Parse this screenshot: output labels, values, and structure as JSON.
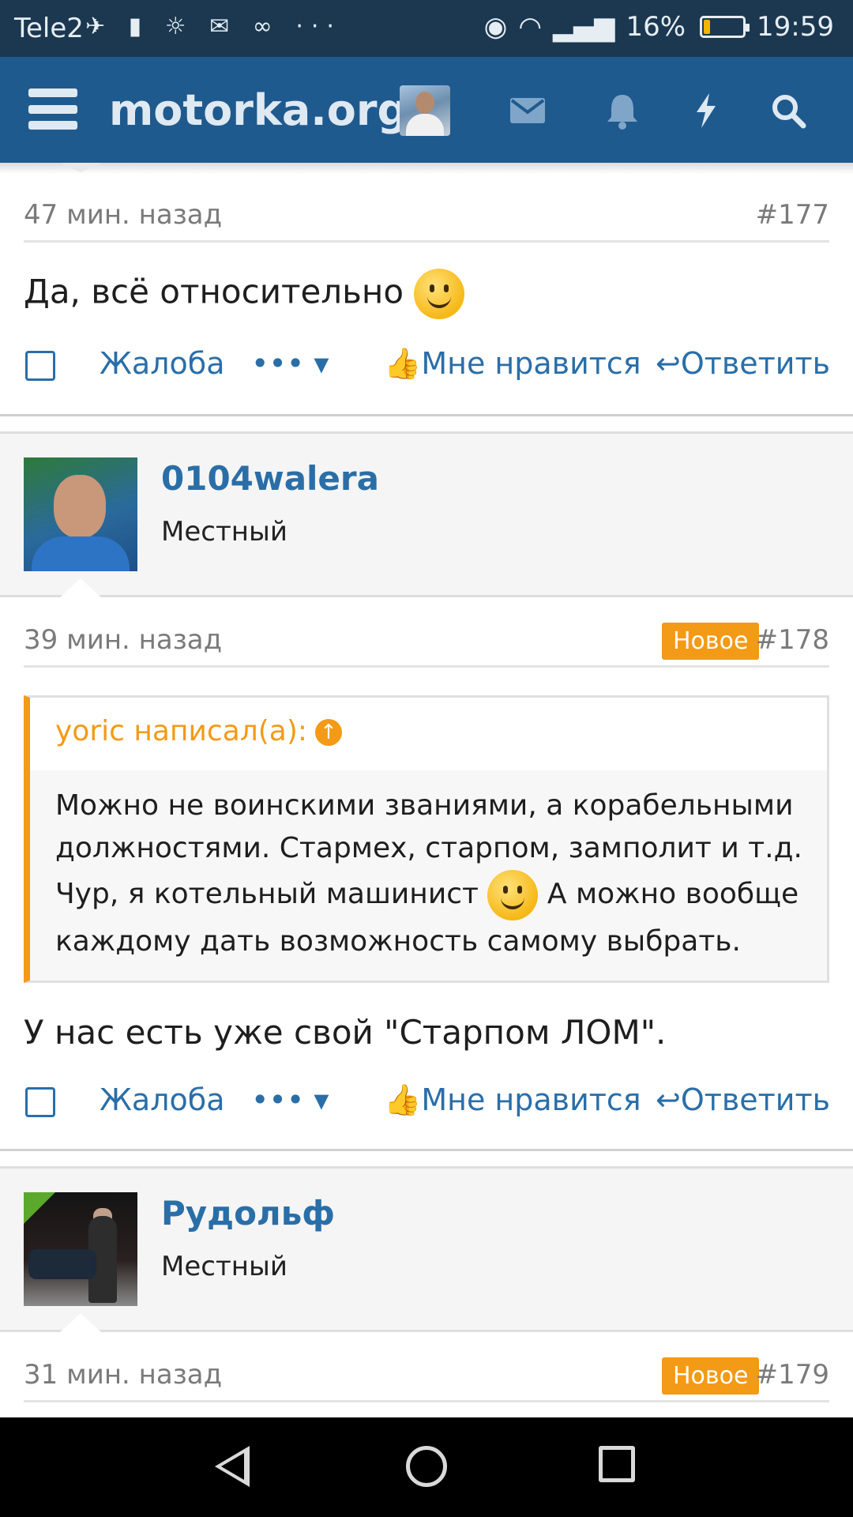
{
  "status_bar": {
    "carrier": "Tele2",
    "notification_icons": "✈ ▮ ☼ ✉ ∞ ···",
    "battery_percent": "16%",
    "time": "19:59",
    "battery_level": 0.16
  },
  "header": {
    "site_name": "motorka.org",
    "icons": [
      "menu-icon",
      "avatar",
      "envelope-icon",
      "bell-icon",
      "lightning-icon",
      "search-icon"
    ]
  },
  "posts": [
    {
      "time": "47 мин. назад",
      "number": "#177",
      "text": "Да, всё относительно",
      "actions": {
        "report": "Жалоба",
        "more": "•••",
        "like": "Мне нравится",
        "reply": "Ответить"
      }
    },
    {
      "author": "0104walera",
      "role": "Местный",
      "time": "39 мин. назад",
      "badge": "Новое",
      "number": "#178",
      "quote": {
        "author_line": "yoric написал(а):",
        "line1": "Можно не воинскими званиями, а корабельными должностями. Стармех, старпом, замполит и т.д.",
        "line2a": "Чур, я котельный машинист",
        "line2b": "А можно вообще каждому дать возможность самому выбрать."
      },
      "text": "У нас есть уже свой \"Старпом ЛОМ\".",
      "actions": {
        "report": "Жалоба",
        "more": "•••",
        "like": "Мне нравится",
        "reply": "Ответить"
      }
    },
    {
      "author": "Рудольф",
      "role": "Местный",
      "time": "31 мин. назад",
      "badge": "Новое",
      "number": "#179"
    }
  ],
  "colors": {
    "status_bar": "#1b3850",
    "header": "#1f5a8e",
    "link": "#2a6ea8",
    "badge": "#f39a16",
    "quote_accent": "#f39a16"
  }
}
